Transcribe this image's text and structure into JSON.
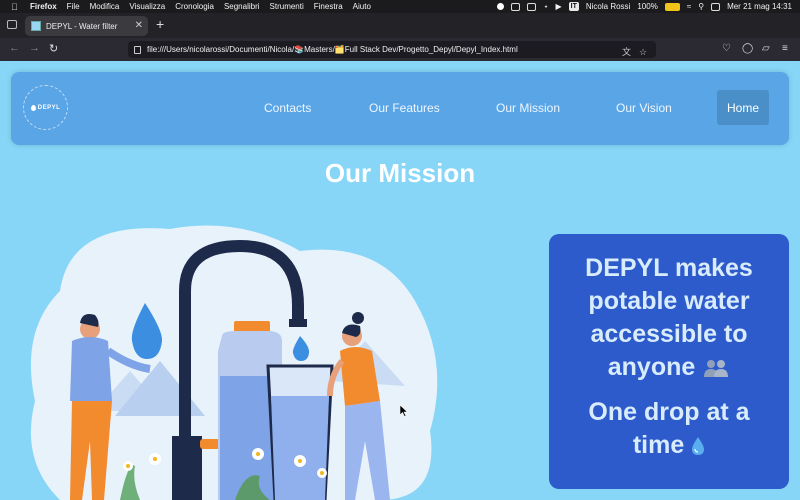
{
  "menubar": {
    "app": "Firefox",
    "items": [
      "File",
      "Modifica",
      "Visualizza",
      "Cronologia",
      "Segnalibri",
      "Strumenti",
      "Finestra",
      "Aiuto"
    ],
    "input_source": "IT",
    "user": "Nicola Rossi",
    "battery": "100%",
    "datetime": "Mer 21 mag  14:31"
  },
  "browser": {
    "tab_title": "DEPYL - Water filter",
    "url": "file:///Users/nicolarossi/Documenti/Nicola/📚Masters/🗂️Full Stack Dev/Progetto_Depyl/Depyl_Index.html"
  },
  "site": {
    "logo_text": "DEPYL",
    "nav": {
      "contacts": "Contacts",
      "features": "Our Features",
      "mission": "Our Mission",
      "vision": "Our Vision",
      "home": "Home"
    },
    "heading": "Our Mission",
    "card": {
      "line1": "DEPYL makes potable water accessible to anyone",
      "line2": "One drop at a time"
    }
  },
  "colors": {
    "page_bg": "#87d6f7",
    "navbar_bg": "#5aa5e6",
    "home_btn": "#4a8fc8",
    "card_bg": "#2d5bcc",
    "card_text": "#d8ecfb"
  }
}
